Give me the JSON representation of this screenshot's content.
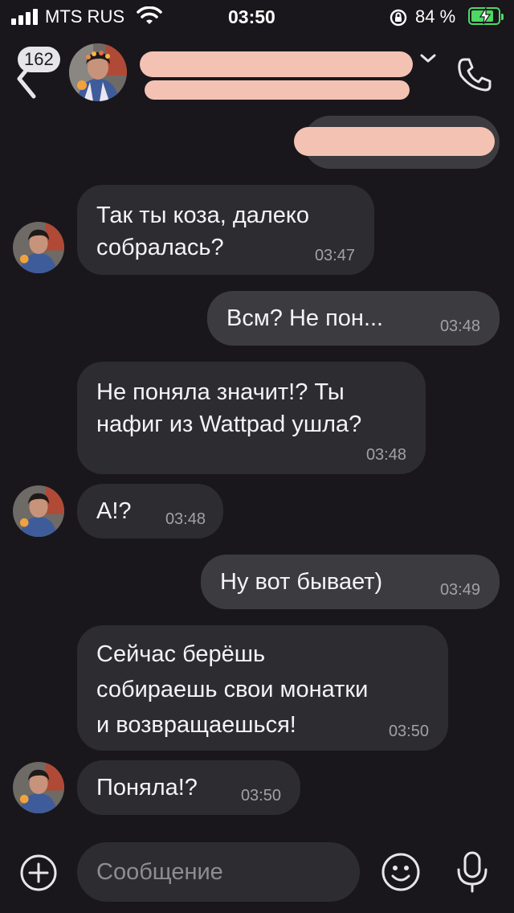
{
  "status_bar": {
    "carrier": "MTS RUS",
    "time": "03:50",
    "battery_percent": "84 %",
    "icons": [
      "signal-icon",
      "wifi-icon",
      "rotation-lock-icon",
      "battery-charging-icon"
    ]
  },
  "header": {
    "unread_count": "162",
    "icons": [
      "back-icon",
      "chevron-down-icon",
      "phone-icon"
    ]
  },
  "messages": [
    {
      "direction": "in",
      "text": "Так ты коза, далеко\nсобралась?",
      "time": "03:47"
    },
    {
      "direction": "out",
      "text": "Всм? Не пон...",
      "time": "03:48"
    },
    {
      "direction": "in",
      "text": "Не поняла значит!? Ты\nнафиг из Wattpad ушла?",
      "time": "03:48"
    },
    {
      "direction": "in",
      "text": "А!?",
      "time": "03:48"
    },
    {
      "direction": "out",
      "text": "Ну вот бывает)",
      "time": "03:49"
    },
    {
      "direction": "in",
      "text": "Сейчас берёшь\nсобираешь свои монатки\nи возвращаешься!",
      "time": "03:50"
    },
    {
      "direction": "in",
      "text": "Поняла!?",
      "time": "03:50"
    }
  ],
  "composer": {
    "placeholder": "Сообщение",
    "icons": [
      "plus-icon",
      "emoji-icon",
      "microphone-icon"
    ]
  },
  "colors": {
    "background": "#19171b",
    "incoming_bubble": "#2d2c31",
    "outgoing_bubble": "#3c3b40",
    "redaction": "#f4c2b3",
    "battery": "#4cd964"
  }
}
